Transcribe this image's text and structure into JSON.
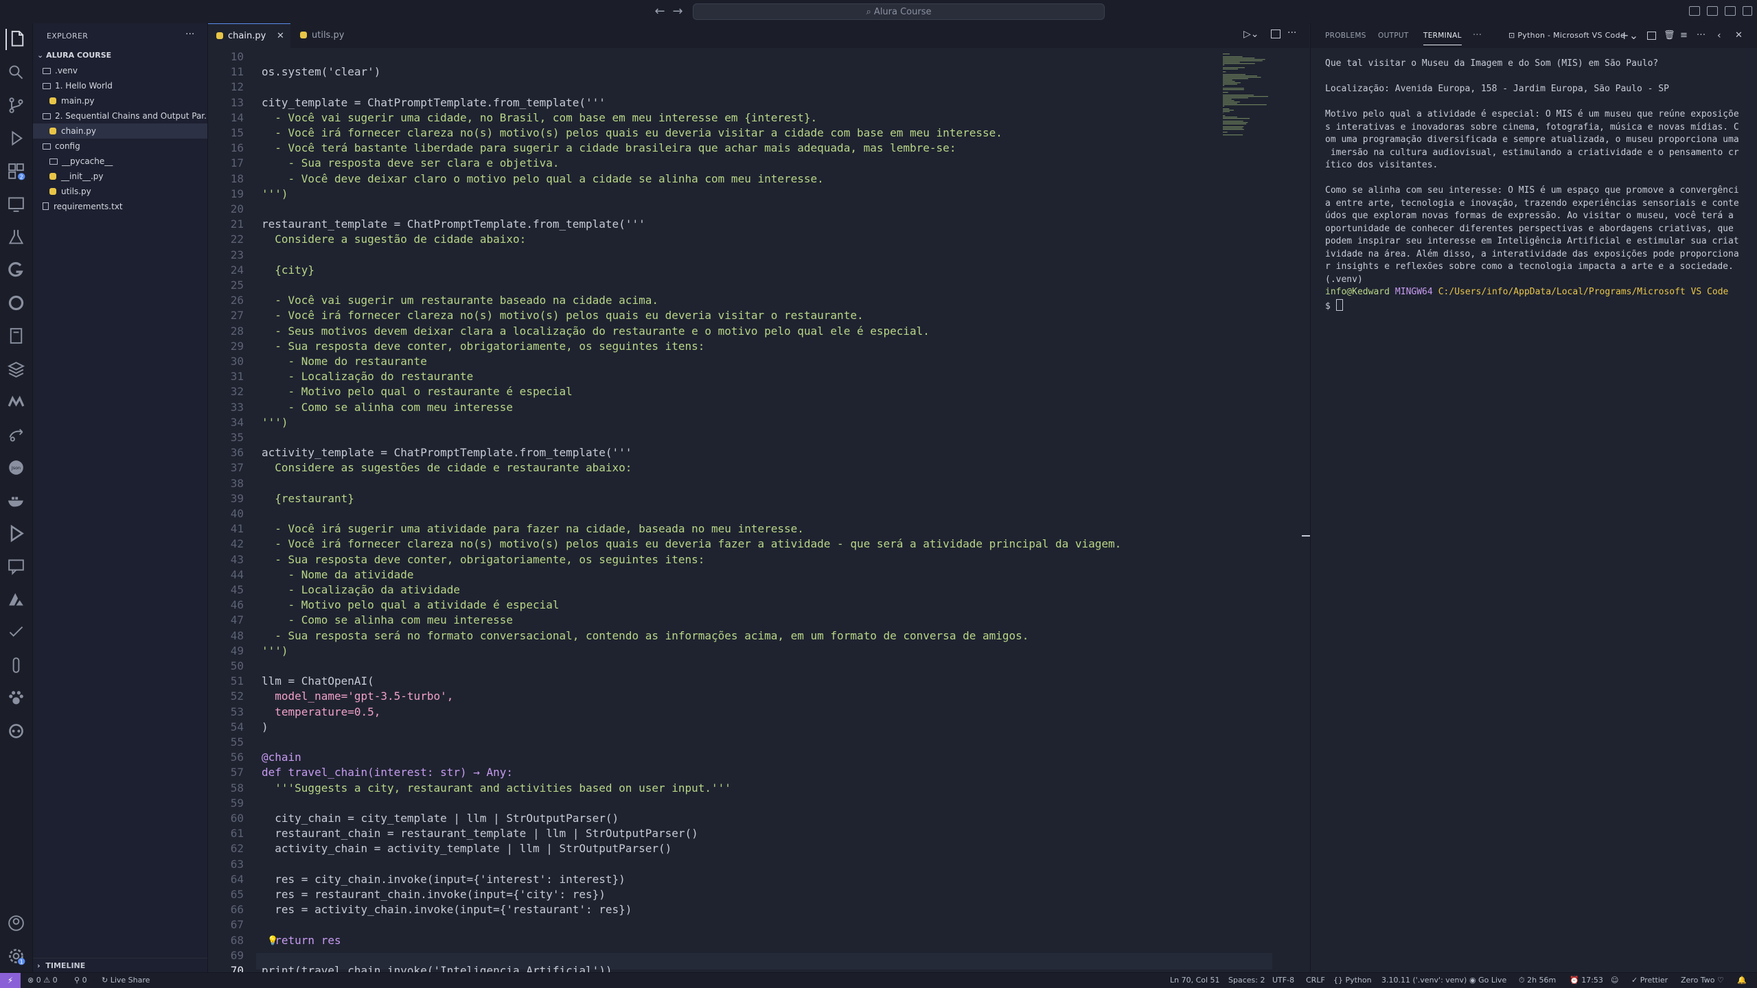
{
  "titlebar": {
    "search_text": "Alura Course",
    "back_icon": "arrow-left-icon",
    "forward_icon": "arrow-right-icon"
  },
  "activitybar": {
    "items": [
      "explorer-icon",
      "search-icon",
      "source-control-icon",
      "run-debug-icon",
      "extensions-icon",
      "remote-explorer-icon",
      "testing-icon",
      "gitlens-icon",
      "edge-icon",
      "notebook-icon",
      "database-icon",
      "mongodb-icon",
      "live-share-icon",
      "json-icon",
      "docker-icon",
      "run-icon",
      "chat-icon",
      "azure-icon",
      "todo-icon",
      "postman-icon",
      "paw-icon",
      "copilot-icon"
    ],
    "extensions_badge": "2",
    "settings_badge": "1",
    "account_icon": "account-icon",
    "settings_icon": "gear-icon"
  },
  "sidebar": {
    "title": "EXPLORER",
    "root": "ALURA COURSE",
    "items": [
      {
        "label": ".venv",
        "type": "folder",
        "depth": 1
      },
      {
        "label": "1. Hello World",
        "type": "folder",
        "depth": 1
      },
      {
        "label": "main.py",
        "type": "py",
        "depth": 2
      },
      {
        "label": "2. Sequential Chains and Output Par...",
        "type": "folder",
        "depth": 1
      },
      {
        "label": "chain.py",
        "type": "py",
        "depth": 2,
        "selected": true
      },
      {
        "label": "config",
        "type": "folder",
        "depth": 1
      },
      {
        "label": "__pycache__",
        "type": "folder",
        "depth": 2
      },
      {
        "label": "__init__.py",
        "type": "py",
        "depth": 2
      },
      {
        "label": "utils.py",
        "type": "py",
        "depth": 2
      },
      {
        "label": "requirements.txt",
        "type": "txt",
        "depth": 1
      }
    ],
    "timeline": "TIMELINE"
  },
  "editor": {
    "tabs": [
      {
        "label": "chain.py",
        "active": true
      },
      {
        "label": "utils.py",
        "active": false
      }
    ],
    "current_line": "70",
    "lines": [
      {
        "n": "10",
        "t": ""
      },
      {
        "n": "11",
        "t": "os.system('clear')"
      },
      {
        "n": "12",
        "t": ""
      },
      {
        "n": "13",
        "t": "city_template = ChatPromptTemplate.from_template('''"
      },
      {
        "n": "14",
        "t": "  - Você vai sugerir uma cidade, no Brasil, com base em meu interesse em {interest}."
      },
      {
        "n": "15",
        "t": "  - Você irá fornecer clareza no(s) motivo(s) pelos quais eu deveria visitar a cidade com base em meu interesse."
      },
      {
        "n": "16",
        "t": "  - Você terá bastante liberdade para sugerir a cidade brasileira que achar mais adequada, mas lembre-se:"
      },
      {
        "n": "17",
        "t": "    - Sua resposta deve ser clara e objetiva."
      },
      {
        "n": "18",
        "t": "    - Você deve deixar claro o motivo pelo qual a cidade se alinha com meu interesse."
      },
      {
        "n": "19",
        "t": "''')"
      },
      {
        "n": "20",
        "t": ""
      },
      {
        "n": "21",
        "t": "restaurant_template = ChatPromptTemplate.from_template('''"
      },
      {
        "n": "22",
        "t": "  Considere a sugestão de cidade abaixo:"
      },
      {
        "n": "23",
        "t": ""
      },
      {
        "n": "24",
        "t": "  {city}"
      },
      {
        "n": "25",
        "t": ""
      },
      {
        "n": "26",
        "t": "  - Você vai sugerir um restaurante baseado na cidade acima."
      },
      {
        "n": "27",
        "t": "  - Você irá fornecer clareza no(s) motivo(s) pelos quais eu deveria visitar o restaurante."
      },
      {
        "n": "28",
        "t": "  - Seus motivos devem deixar clara a localização do restaurante e o motivo pelo qual ele é especial."
      },
      {
        "n": "29",
        "t": "  - Sua resposta deve conter, obrigatoriamente, os seguintes itens:"
      },
      {
        "n": "30",
        "t": "    - Nome do restaurante"
      },
      {
        "n": "31",
        "t": "    - Localização do restaurante"
      },
      {
        "n": "32",
        "t": "    - Motivo pelo qual o restaurante é especial"
      },
      {
        "n": "33",
        "t": "    - Como se alinha com meu interesse"
      },
      {
        "n": "34",
        "t": "''')"
      },
      {
        "n": "35",
        "t": ""
      },
      {
        "n": "36",
        "t": "activity_template = ChatPromptTemplate.from_template('''"
      },
      {
        "n": "37",
        "t": "  Considere as sugestões de cidade e restaurante abaixo:"
      },
      {
        "n": "38",
        "t": ""
      },
      {
        "n": "39",
        "t": "  {restaurant}"
      },
      {
        "n": "40",
        "t": ""
      },
      {
        "n": "41",
        "t": "  - Você irá sugerir uma atividade para fazer na cidade, baseada no meu interesse."
      },
      {
        "n": "42",
        "t": "  - Você irá fornecer clareza no(s) motivo(s) pelos quais eu deveria fazer a atividade - que será a atividade principal da viagem."
      },
      {
        "n": "43",
        "t": "  - Sua resposta deve conter, obrigatoriamente, os seguintes itens:"
      },
      {
        "n": "44",
        "t": "    - Nome da atividade"
      },
      {
        "n": "45",
        "t": "    - Localização da atividade"
      },
      {
        "n": "46",
        "t": "    - Motivo pelo qual a atividade é especial"
      },
      {
        "n": "47",
        "t": "    - Como se alinha com meu interesse"
      },
      {
        "n": "48",
        "t": "  - Sua resposta será no formato conversacional, contendo as informações acima, em um formato de conversa de amigos."
      },
      {
        "n": "49",
        "t": "''')"
      },
      {
        "n": "50",
        "t": ""
      },
      {
        "n": "51",
        "t": "llm = ChatOpenAI("
      },
      {
        "n": "52",
        "t": "  model_name='gpt-3.5-turbo',"
      },
      {
        "n": "53",
        "t": "  temperature=0.5,"
      },
      {
        "n": "54",
        "t": ")"
      },
      {
        "n": "55",
        "t": ""
      },
      {
        "n": "56",
        "t": "@chain"
      },
      {
        "n": "57",
        "t": "def travel_chain(interest: str) → Any:"
      },
      {
        "n": "58",
        "t": "  '''Suggests a city, restaurant and activities based on user input.'''"
      },
      {
        "n": "59",
        "t": ""
      },
      {
        "n": "60",
        "t": "  city_chain = city_template | llm | StrOutputParser()"
      },
      {
        "n": "61",
        "t": "  restaurant_chain = restaurant_template | llm | StrOutputParser()"
      },
      {
        "n": "62",
        "t": "  activity_chain = activity_template | llm | StrOutputParser()"
      },
      {
        "n": "63",
        "t": ""
      },
      {
        "n": "64",
        "t": "  res = city_chain.invoke(input={'interest': interest})"
      },
      {
        "n": "65",
        "t": "  res = restaurant_chain.invoke(input={'city': res})"
      },
      {
        "n": "66",
        "t": "  res = activity_chain.invoke(input={'restaurant': res})"
      },
      {
        "n": "67",
        "t": ""
      },
      {
        "n": "68",
        "t": "  return res"
      },
      {
        "n": "69",
        "t": ""
      },
      {
        "n": "70",
        "t": "print(travel_chain.invoke('Inteligencia Artificial'))"
      }
    ]
  },
  "panel": {
    "tabs": [
      "PROBLEMS",
      "OUTPUT",
      "TERMINAL"
    ],
    "active_tab": "TERMINAL",
    "terminal_name": "Python - Microsoft VS Code",
    "terminal_lines": [
      "Que tal visitar o Museu da Imagem e do Som (MIS) em São Paulo?",
      "",
      "Localização: Avenida Europa, 158 - Jardim Europa, São Paulo - SP",
      "",
      "Motivo pelo qual a atividade é especial: O MIS é um museu que reúne exposiçõe",
      "s interativas e inovadoras sobre cinema, fotografia, música e novas mídias. C",
      "om uma programação diversificada e sempre atualizada, o museu proporciona uma",
      " imersão na cultura audiovisual, estimulando a criatividade e o pensamento cr",
      "ítico dos visitantes.",
      "",
      "Como se alinha com seu interesse: O MIS é um espaço que promove a convergênci",
      "a entre arte, tecnologia e inovação, trazendo experiências sensoriais e conte",
      "údos que exploram novas formas de expressão. Ao visitar o museu, você terá a",
      "oportunidade de conhecer diferentes perspectivas e abordagens criativas, que",
      "podem inspirar seu interesse em Inteligência Artificial e estimular sua criat",
      "ividade na área. Além disso, a interatividade das exposições pode proporciona",
      "r insights e reflexões sobre como a tecnologia impacta a arte e a sociedade.",
      "(.venv)"
    ],
    "prompt_user": "info@Kedward",
    "prompt_host": "MINGW64",
    "prompt_path": "C:/Users/info/AppData/Local/Programs/Microsoft VS Code",
    "prompt_symbol": "$"
  },
  "statusbar": {
    "errors": "0",
    "warnings": "0",
    "ports": "0",
    "live_share": "Live Share",
    "position": "Ln 70, Col 51",
    "spaces": "Spaces: 2",
    "encoding": "UTF-8",
    "eol": "CRLF",
    "language": "Python",
    "interpreter": "3.10.11 ('.venv': venv)",
    "go_live": "Go Live",
    "time_spent": "2h 56m",
    "clock": "17:53",
    "prettier": "Prettier",
    "theme": "Zero Two"
  },
  "colors": {
    "accent": "#5b8def",
    "remote": "#8a61d6",
    "string": "#b8d686",
    "keyword": "#c79bf0",
    "param": "#f0a0c8",
    "number": "#f78c6c",
    "prompt_user": "#b8d686",
    "prompt_host": "#c79bf0",
    "prompt_path": "#e8c547"
  }
}
